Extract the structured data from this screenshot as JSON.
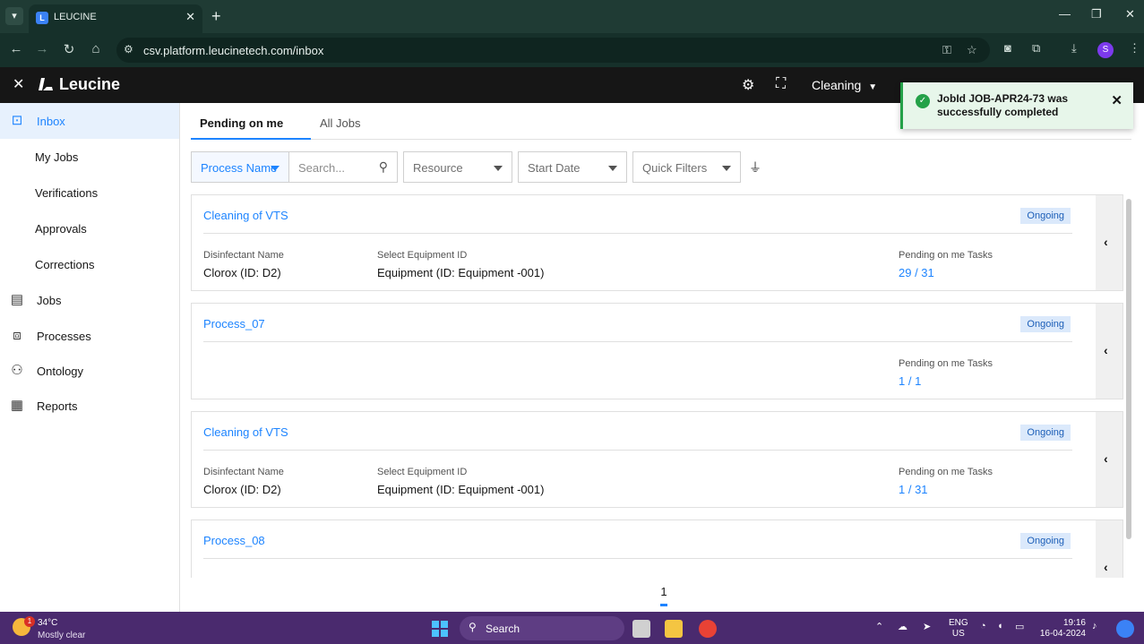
{
  "browser": {
    "tab_title": "LEUCINE",
    "url": "csv.platform.leucinetech.com/inbox"
  },
  "app": {
    "name": "Leucine",
    "facility": "Cleaning"
  },
  "sidebar": {
    "items": [
      {
        "label": "Inbox",
        "icon": "inbox-icon",
        "active": true
      },
      {
        "label": "My Jobs",
        "sub": true
      },
      {
        "label": "Verifications",
        "sub": true
      },
      {
        "label": "Approvals",
        "sub": true
      },
      {
        "label": "Corrections",
        "sub": true
      },
      {
        "label": "Jobs",
        "icon": "clipboard-icon"
      },
      {
        "label": "Processes",
        "icon": "flowchart-icon"
      },
      {
        "label": "Ontology",
        "icon": "hierarchy-icon"
      },
      {
        "label": "Reports",
        "icon": "report-icon"
      }
    ]
  },
  "tabs": [
    {
      "label": "Pending on me",
      "active": true
    },
    {
      "label": "All Jobs",
      "active": false
    }
  ],
  "filters": {
    "process_name": "Process Name",
    "search_placeholder": "Search...",
    "resource": "Resource",
    "start_date": "Start Date",
    "quick_filters": "Quick Filters"
  },
  "cards": [
    {
      "process": "Cleaning of VTS",
      "status": "Ongoing",
      "fields": [
        {
          "label": "Disinfectant Name",
          "value": "Clorox (ID: D2)"
        },
        {
          "label": "Select Equipment ID",
          "value": "Equipment (ID: Equipment -001)"
        }
      ],
      "tasks_label": "Pending on me Tasks",
      "tasks": "29 / 31"
    },
    {
      "process": "Process_07",
      "status": "Ongoing",
      "fields": [],
      "tasks_label": "Pending on me Tasks",
      "tasks": "1 / 1"
    },
    {
      "process": "Cleaning of VTS",
      "status": "Ongoing",
      "fields": [
        {
          "label": "Disinfectant Name",
          "value": "Clorox (ID: D2)"
        },
        {
          "label": "Select Equipment ID",
          "value": "Equipment (ID: Equipment -001)"
        }
      ],
      "tasks_label": "Pending on me Tasks",
      "tasks": "1 / 31"
    },
    {
      "process": "Process_08",
      "status": "Ongoing",
      "fields": [],
      "tasks_label": "",
      "tasks": ""
    }
  ],
  "pagination": {
    "current_page": "1"
  },
  "toast": {
    "message": "JobId JOB-APR24-73 was successfully completed"
  },
  "taskbar": {
    "temperature": "34°C",
    "condition": "Mostly clear",
    "weather_badge": "1",
    "search_label": "Search",
    "lang_1": "ENG",
    "lang_2": "US",
    "time": "19:16",
    "date": "16-04-2024"
  },
  "colors": {
    "accent": "#1d84ff",
    "header_bg": "#161616",
    "success": "#24a148",
    "taskbar_bg": "#4a2a6e"
  }
}
